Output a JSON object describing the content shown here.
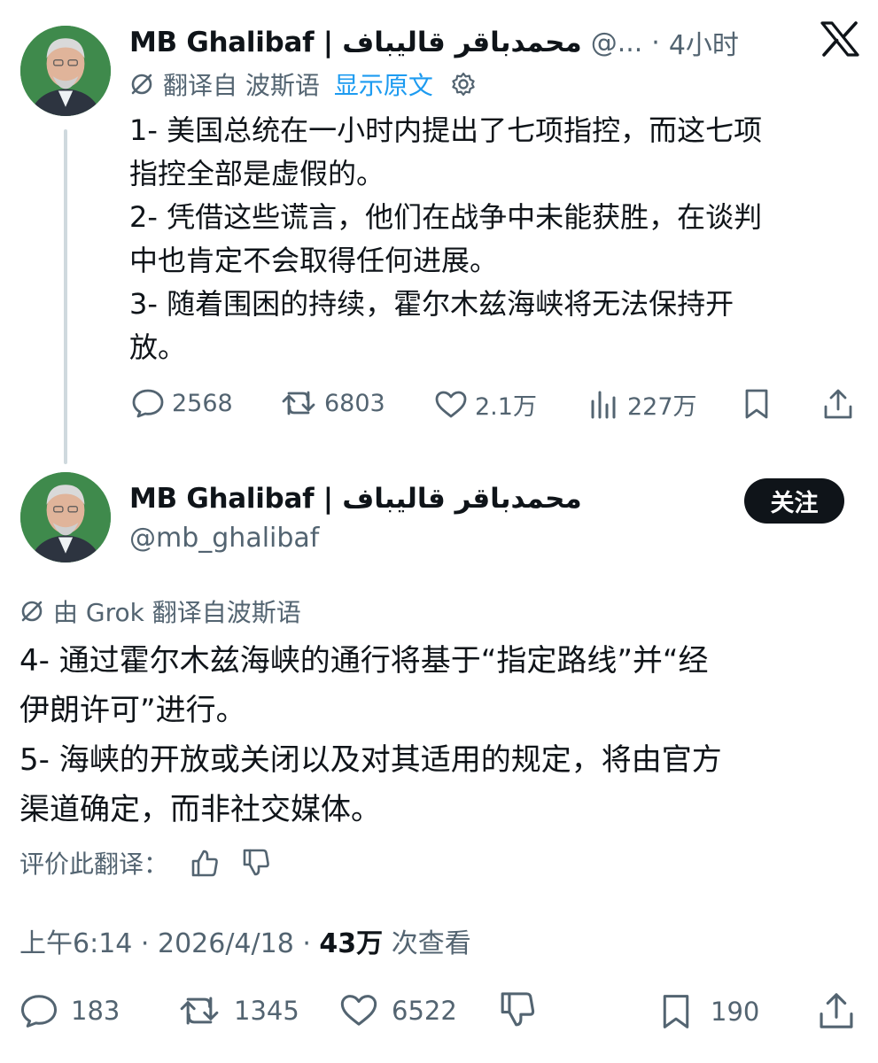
{
  "tweet1": {
    "author_name": "MB Ghalibaf | محمدباقر قالیباف",
    "handle": "@...",
    "separator": "·",
    "time": "4小时",
    "translated_from": "翻译自 波斯语",
    "show_original": "显示原文",
    "text": "1- 美国总统在一小时内提出了七项指控，而这七项\n指控全部是虚假的。\n2- 凭借这些谎言，他们在战争中未能获胜，在谈判\n中也肯定不会取得任何进展。\n3- 随着围困的持续，霍尔木兹海峡将无法保持开\n放。",
    "replies": "2568",
    "reposts": "6803",
    "likes": "2.1万",
    "views": "227万"
  },
  "tweet2": {
    "author_name": "MB Ghalibaf | محمدباقر قالیباف",
    "handle": "@mb_ghalibaf",
    "follow_label": "关注",
    "translated_by": "由 Grok 翻译自波斯语",
    "text": "4- 通过霍尔木兹海峡的通行将基于“指定路线”并“经\n伊朗许可”进行。\n5- 海峡的开放或关闭以及对其适用的规定，将由官方\n渠道确定，而非社交媒体。",
    "rate_translation": "评价此翻译：",
    "timestamp": "上午6:14 · 2026/4/18 · ",
    "views_count": "43万",
    "views_label": " 次查看",
    "replies": "183",
    "reposts": "1345",
    "likes": "6522",
    "bookmarks": "190"
  },
  "colors": {
    "text": "#0f1419",
    "secondary": "#536471",
    "link": "#1d9bf0",
    "thread_line": "#cfd9de"
  },
  "icons": [
    "x-logo-icon",
    "translate-off-icon",
    "gear-icon",
    "reply-icon",
    "repost-icon",
    "like-icon",
    "views-icon",
    "bookmark-icon",
    "share-icon",
    "thumbs-up-icon",
    "thumbs-down-icon",
    "dislike-icon"
  ]
}
